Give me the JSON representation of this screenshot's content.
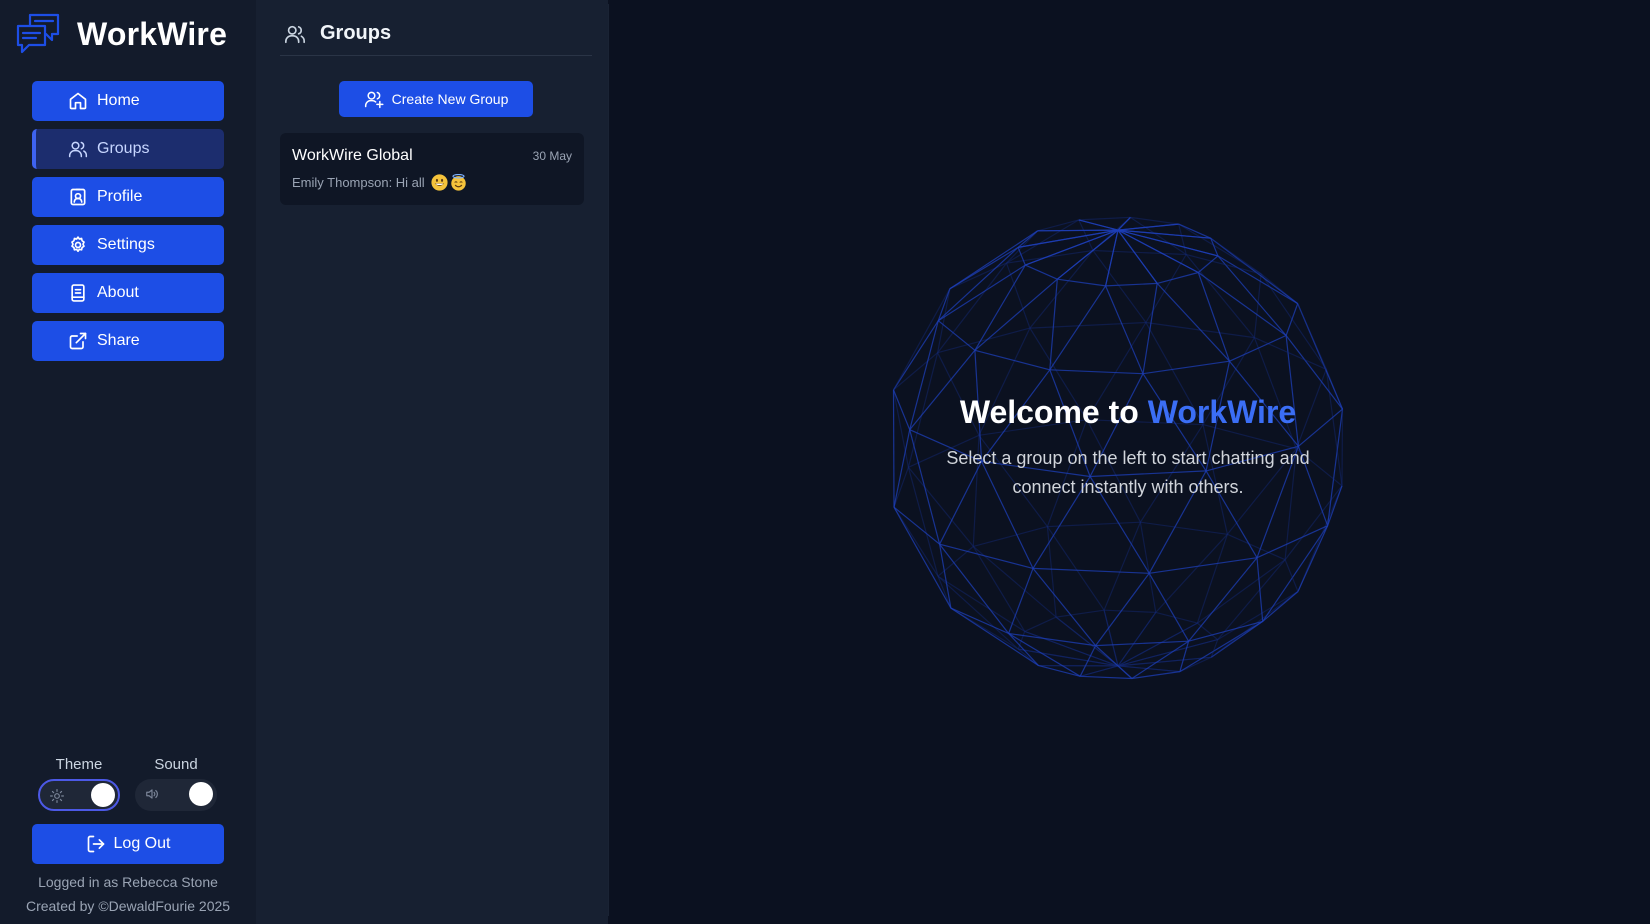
{
  "app": {
    "name": "WorkWire"
  },
  "sidebar": {
    "nav": [
      {
        "label": "Home",
        "icon": "home-icon",
        "active": false
      },
      {
        "label": "Groups",
        "icon": "users-icon",
        "active": true
      },
      {
        "label": "Profile",
        "icon": "profile-icon",
        "active": false
      },
      {
        "label": "Settings",
        "icon": "gear-icon",
        "active": false
      },
      {
        "label": "About",
        "icon": "book-icon",
        "active": false
      },
      {
        "label": "Share",
        "icon": "external-link-icon",
        "active": false
      }
    ],
    "theme_label": "Theme",
    "sound_label": "Sound",
    "theme_on": true,
    "sound_on": true,
    "logout_label": "Log Out",
    "logged_in_text": "Logged in as Rebecca Stone",
    "credit_text": "Created by ©DewaldFourie 2025"
  },
  "groups": {
    "title": "Groups",
    "create_label": "Create New Group",
    "items": [
      {
        "name": "WorkWire Global",
        "date": "30 May",
        "preview": "Emily Thompson: Hi all",
        "emojis": [
          "grinning-face-emoji",
          "smiling-face-with-halo-emoji"
        ]
      }
    ]
  },
  "main": {
    "welcome_prefix": "Welcome to ",
    "welcome_brand": "WorkWire",
    "welcome_sub": "Select a group on the left to start chatting and connect instantly with others."
  },
  "colors": {
    "accent": "#1d4ee6",
    "brand_text": "#3b6ef5",
    "background": "#0b1120"
  }
}
